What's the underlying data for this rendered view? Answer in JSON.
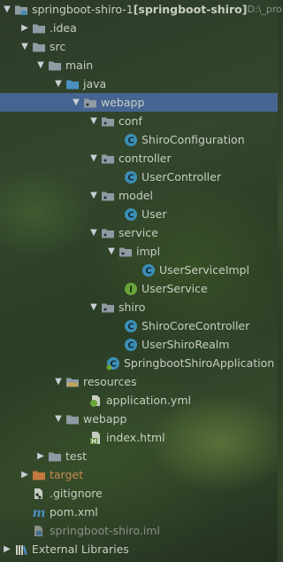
{
  "project": {
    "root_name": "springboot-shiro-1",
    "module_name": "[springboot-shiro]",
    "path": "D:\\_pro"
  },
  "tree": {
    "idea": ".idea",
    "src": "src",
    "main": "main",
    "java": "java",
    "webapp_pkg": "webapp",
    "conf": "conf",
    "shiro_configuration": "ShiroConfiguration",
    "controller": "controller",
    "user_controller": "UserController",
    "model": "model",
    "user": "User",
    "service": "service",
    "impl": "impl",
    "user_service_impl": "UserServiceImpl",
    "user_service": "UserService",
    "shiro": "shiro",
    "shiro_core_controller": "ShiroCoreController",
    "user_shiro_realm": "UserShiroRealm",
    "springboot_shiro_application": "SpringbootShiroApplication",
    "resources": "resources",
    "application_yml": "application.yml",
    "webapp_dir": "webapp",
    "index_html": "index.html",
    "test": "test",
    "target": "target",
    "gitignore": ".gitignore",
    "pom": "pom.xml",
    "iml": "springboot-shiro.iml",
    "external_libraries": "External Libraries"
  },
  "icons": {
    "class_letter": "C",
    "interface_letter": "I",
    "html_letter": "H",
    "maven_letter": "m"
  },
  "colors": {
    "selection": "#4b6eaf",
    "class_icon": "#3d8eb5",
    "interface_icon": "#6aa33a",
    "folder": "#8f9aa3",
    "source_folder": "#4a8ec2",
    "target_folder": "#c2783f"
  }
}
